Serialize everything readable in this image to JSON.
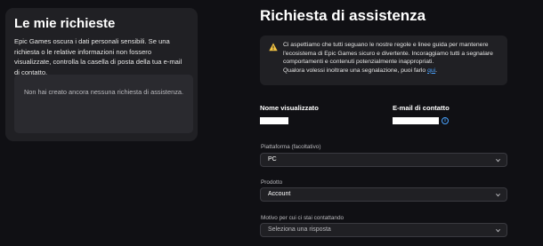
{
  "left": {
    "title": "Le mie richieste",
    "description": "Epic Games oscura i dati personali sensibili. Se una richiesta o le relative informazioni non fossero visualizzate, controlla la casella di posta della tua e-mail di contatto.",
    "empty_message": "Non hai creato ancora nessuna richiesta di assistenza."
  },
  "main": {
    "title": "Richiesta di assistenza",
    "notice": {
      "icon": "warning-icon",
      "text": "Ci aspettiamo che tutti seguano le nostre regole e linee guida per mantenere l'ecosistema di Epic Games sicuro e divertente. Incoraggiamo tutti a segnalare comportamenti e contenuti potenzialmente inappropriati.",
      "text2": "Qualora volessi inoltrare una segnalazione, puoi farlo ",
      "link": "qui",
      "text_end": "."
    },
    "display_name_label": "Nome visualizzato",
    "email_label": "E-mail di contatto",
    "platform": {
      "label": "Piattaforma (facoltativo)",
      "value": "PC"
    },
    "product": {
      "label": "Prodotto",
      "value": "Account"
    },
    "reason": {
      "label": "Motivo per cui ci stai contattando",
      "placeholder": "Seleziona una risposta"
    }
  },
  "colors": {
    "background": "#101014",
    "card": "#202024",
    "link": "#4aa3ff",
    "warning": "#f5c542"
  }
}
